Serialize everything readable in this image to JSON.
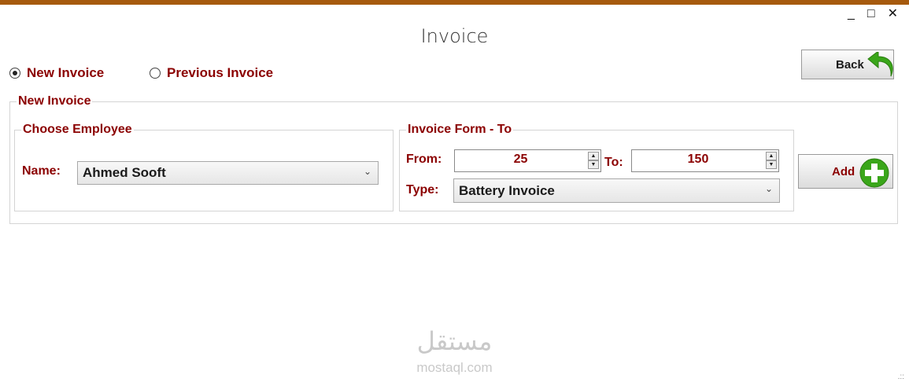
{
  "window": {
    "title": "Invoice",
    "controls": {
      "minimize": "_",
      "maximize": "□",
      "close": "✕"
    }
  },
  "mode": {
    "options": [
      {
        "label": "New Invoice",
        "selected": true
      },
      {
        "label": "Previous Invoice",
        "selected": false
      }
    ]
  },
  "back_button": {
    "label": "Back",
    "icon": "back-arrow-icon"
  },
  "new_invoice_group": {
    "title": "New Invoice",
    "employee_group": {
      "title": "Choose Employee",
      "name_label": "Name:",
      "name_value": "Ahmed Sooft"
    },
    "form_group": {
      "title": "Invoice Form - To",
      "from_label": "From:",
      "from_value": "25",
      "to_label": "To:",
      "to_value": "150",
      "type_label": "Type:",
      "type_value": "Battery Invoice"
    },
    "add_button": {
      "label": "Add",
      "icon": "add-plus-icon"
    }
  },
  "watermark": {
    "arabic": "مستقل",
    "latin": "mostaql.com"
  },
  "colors": {
    "accent_bar": "#a65a0e",
    "label": "#8b0000"
  }
}
